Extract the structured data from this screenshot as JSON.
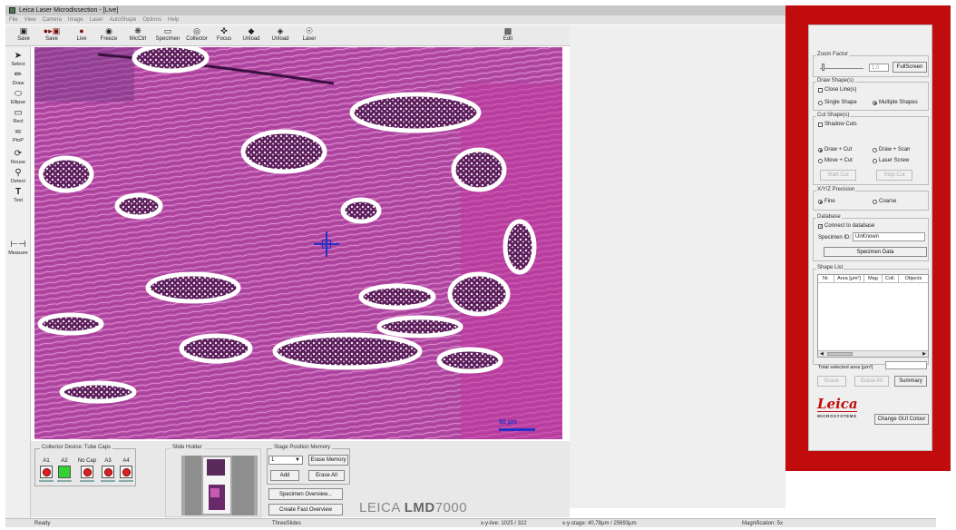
{
  "window": {
    "title": "Leica Laser Microdissection - [Live]"
  },
  "menu": [
    "File",
    "View",
    "Camera",
    "Image",
    "Laser",
    "AutoShape",
    "Options",
    "Help"
  ],
  "toolbar": [
    {
      "label": "Save",
      "icon": "floppy-icon"
    },
    {
      "label": "Save",
      "icon": "record-save-icon"
    },
    {
      "label": "Live",
      "icon": "live-dot-icon"
    },
    {
      "label": "Freeze",
      "icon": "freeze-icon"
    },
    {
      "label": "MicCtrl",
      "icon": "microscope-control-icon"
    },
    {
      "label": "Specimen",
      "icon": "specimen-icon"
    },
    {
      "label": "Collector",
      "icon": "collector-icon"
    },
    {
      "label": "Focus",
      "icon": "focus-icon"
    },
    {
      "label": "Unload",
      "icon": "unload-icon"
    },
    {
      "label": "Unload",
      "icon": "unload-2-icon"
    },
    {
      "label": "Laser",
      "icon": "laser-icon"
    },
    {
      "label": "Edit",
      "icon": "edit-icon"
    }
  ],
  "tools": [
    {
      "label": "Select",
      "icon": "arrow-cursor-icon"
    },
    {
      "label": "Draw",
      "icon": "pencil-icon"
    },
    {
      "label": "Ellipse",
      "icon": "ellipse-icon"
    },
    {
      "label": "Rect",
      "icon": "rectangle-icon"
    },
    {
      "label": "PtoP",
      "icon": "point-to-point-icon"
    },
    {
      "label": "Reuse",
      "icon": "reuse-icon"
    },
    {
      "label": "Detect",
      "icon": "detect-icon"
    },
    {
      "label": "Text",
      "icon": "text-tool-icon"
    },
    {
      "label": "Measure",
      "icon": "measure-icon"
    }
  ],
  "viewer": {
    "scale_label": "50 µm"
  },
  "collector": {
    "title": "Collector Device: Tube Caps",
    "slots": [
      {
        "label": "A1",
        "cap": "red"
      },
      {
        "label": "A2",
        "cap": "green"
      },
      {
        "label": "No Cap",
        "cap": "red"
      },
      {
        "label": "A3",
        "cap": "red"
      },
      {
        "label": "A4",
        "cap": "red"
      }
    ]
  },
  "slide_holder": {
    "title": "Slide Holder"
  },
  "stage": {
    "title": "Stage Position Memory",
    "select_value": "1",
    "erase_memory": "Erase Memory",
    "add": "Add",
    "erase_all": "Erase All",
    "specimen_overview": "Specimen Overview...",
    "create_fast_overview": "Create Fast Overview"
  },
  "brand": {
    "maker": "LEICA",
    "model": "LMD",
    "number": "7000"
  },
  "status": {
    "ready": "Ready",
    "slides": "ThreeSlides",
    "xy_live": "x-y-live: 1025 / 322",
    "xy_stage": "x-y-stage: 40,78µm / 25693µm",
    "magnification": "Magnification: 5x"
  },
  "panel": {
    "zoom": {
      "title": "Zoom Factor",
      "value": "1.0",
      "fullscreen": "FullScreen"
    },
    "draw_shapes": {
      "title": "Draw Shape(s)",
      "close_line": "Close Line(s)",
      "single": "Single Shape",
      "multiple": "Multiple Shapes"
    },
    "cut_shapes": {
      "title": "Cut Shape(s)",
      "shadow": "Shadow Cuts",
      "draw_cut": "Draw + Cut",
      "draw_scan": "Draw + Scan",
      "move_cut": "Move + Cut",
      "laser_screw": "Laser Screw",
      "start_cut": "Start Cut",
      "stop_cut": "Stop Cut"
    },
    "precision": {
      "title": "X/Y/Z Precision",
      "fine": "Fine",
      "coarse": "Coarse"
    },
    "database": {
      "title": "Database",
      "connect": "Connect to database",
      "specimen_id_label": "Specimen ID:",
      "specimen_id": "UnKnown",
      "specimen_data": "Specimen Data"
    },
    "shape_list": {
      "title": "Shape List",
      "columns": [
        "Nr.",
        "Area [µm²]",
        "Mag",
        "Coll.",
        "Objects"
      ]
    },
    "total_area_label": "Total selected area [µm²]",
    "erase": "Erase",
    "erase_all": "Erase All",
    "summary": "Summary",
    "logo": {
      "word": "Leica",
      "sub": "MICROSYSTEMS"
    },
    "change_gui": "Change GUI Colour"
  },
  "colors": {
    "accent_red": "#c00c0c",
    "tissue": "#c85ab4",
    "crosshair": "#2030c8"
  }
}
